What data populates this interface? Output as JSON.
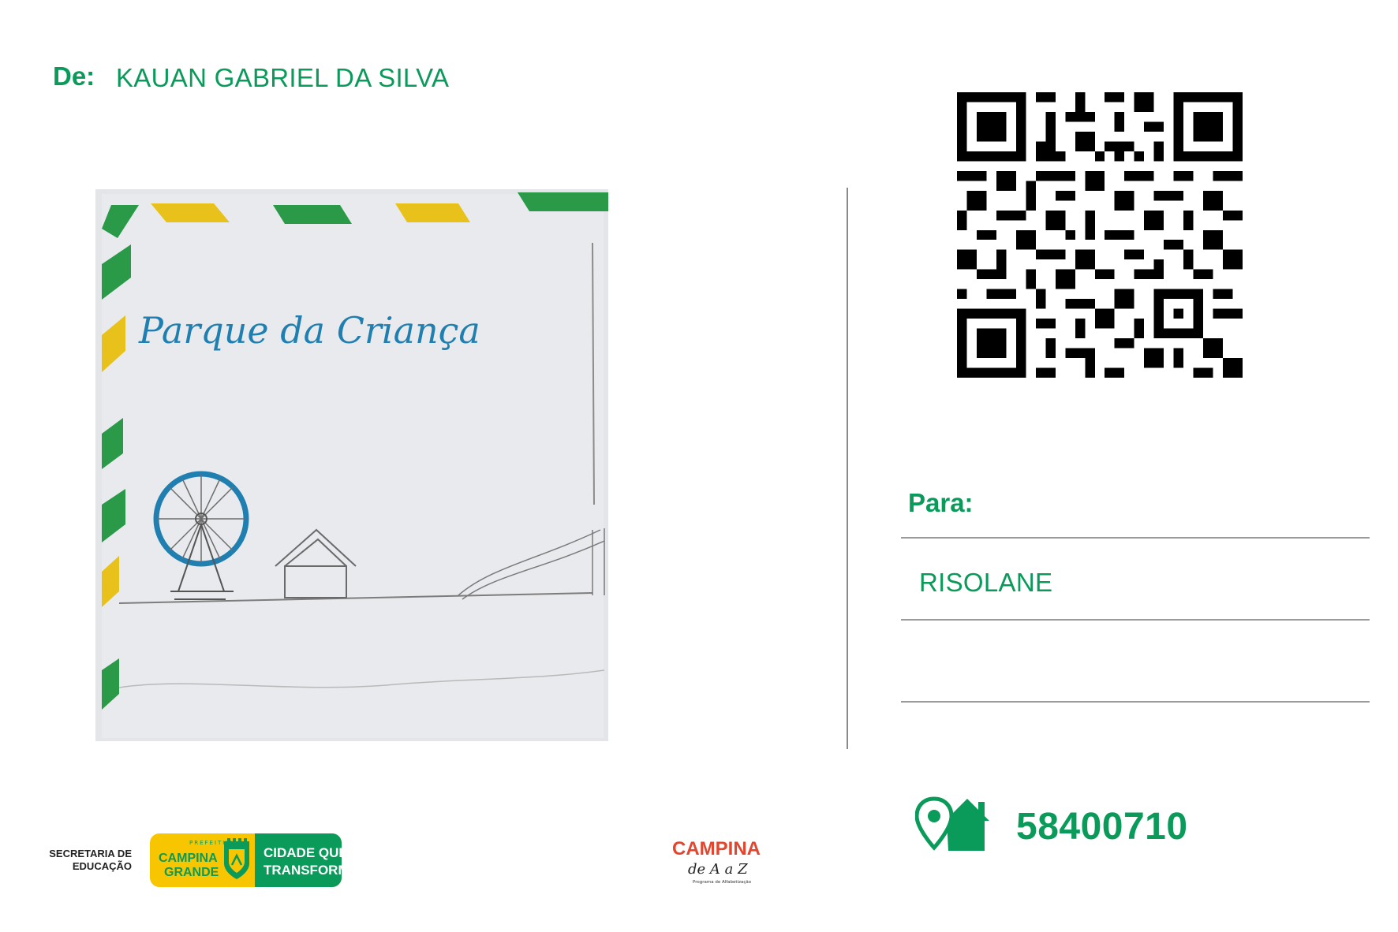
{
  "header": {
    "from_label": "De:",
    "from_name": "KAUAN GABRIEL DA SILVA"
  },
  "drawing": {
    "title_text": "Parque da Criança"
  },
  "recipient": {
    "to_label": "Para:",
    "to_name": "RISOLANE"
  },
  "postal": {
    "cep": "58400710",
    "icon": "house-location-icon"
  },
  "footer": {
    "secretaria_line1": "SECRETARIA DE",
    "secretaria_line2": "EDUCAÇÃO",
    "prefeitura_small": "PREFEITURA",
    "prefeitura_city_line1": "CAMPINA",
    "prefeitura_city_line2": "GRANDE",
    "slogan_line1": "CIDADE QUE",
    "slogan_line2": "TRANSFORMA",
    "program_name": "CAMPINA",
    "program_tagline": "de A a Z",
    "program_subtitle": "Programa de Alfabetização"
  },
  "colors": {
    "brand_green": "#0a9a5a",
    "brand_yellow": "#f7c600",
    "drawing_blue": "#1f7fb0"
  }
}
